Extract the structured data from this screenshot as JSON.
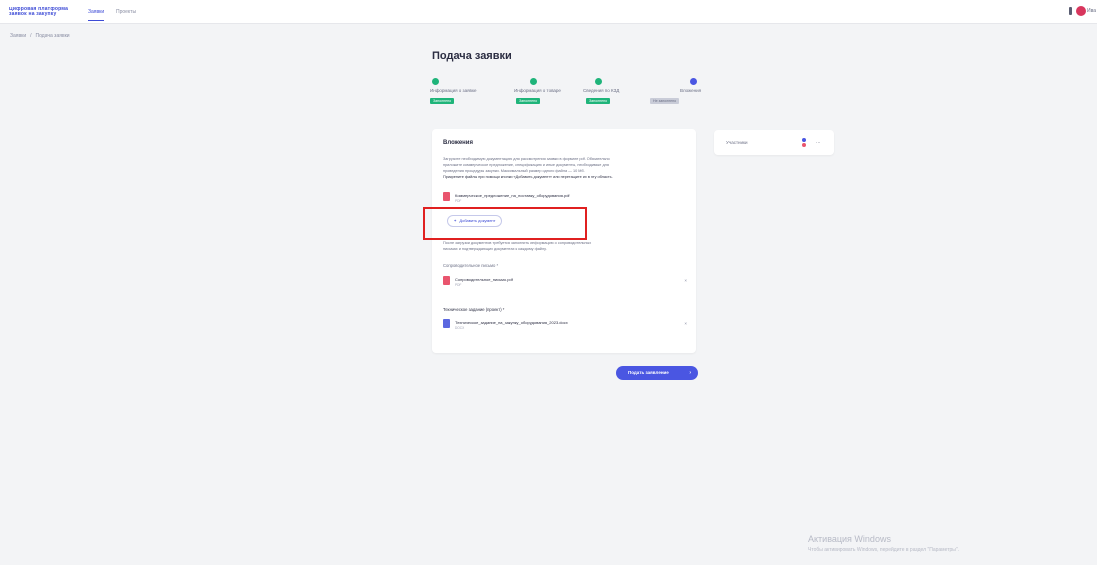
{
  "header": {
    "logo_line1": "Цифровая платформа",
    "logo_line2": "заявок на закупку",
    "tabs": [
      {
        "label": "Заявки",
        "active": true
      },
      {
        "label": "Проекты",
        "active": false
      }
    ],
    "user_label": "Ива"
  },
  "breadcrumb": {
    "items": [
      "Заявки",
      "Подача заявки"
    ]
  },
  "page": {
    "title": "Подача заявки"
  },
  "stepper": {
    "steps": [
      {
        "label": "Информация о заявке",
        "status": "Заполнено",
        "state": "done",
        "color": "#1fb47a"
      },
      {
        "label": "Информация о товаре",
        "status": "Заполнено",
        "state": "done",
        "color": "#1fb47a"
      },
      {
        "label": "Сведения по КЗД",
        "status": "Заполнено",
        "state": "done",
        "color": "#1fb47a"
      },
      {
        "label": "Вложения",
        "status": "Не заполнено",
        "state": "current",
        "color": "#4a56e2"
      }
    ]
  },
  "card": {
    "title": "Вложения",
    "description": [
      "Загрузите необходимую документацию для рассмотрения заявки в формате pdf. Обязательно",
      "приложите коммерческое предложение, спецификацию и иные документы, необходимые для",
      "проведения процедуры закупки. Максимальный размер одного файла — 10 Мб.",
      "Прикрепите файлы при помощи кнопки «Добавить документ» или перетащите их в эту область."
    ],
    "file1": {
      "name": "Коммерческое_предложение_на_поставку_оборудования.pdf",
      "sub": "PDF"
    },
    "add_button": "Добавить документ",
    "note": [
      "После загрузки документов требуется заполнить информацию о сопроводительных",
      "письмах и подтверждающих документах к каждому файлу."
    ],
    "section1_label": "Сопроводительное письмо *",
    "file2": {
      "name": "Сопроводительное_письмо.pdf",
      "sub": "PDF",
      "action": "×"
    },
    "section2_label": "Техническое задание (проект) *",
    "file3": {
      "name": "Техническое_задание_на_закупку_оборудования_2023.docx",
      "sub": "DOCX",
      "action": "×"
    }
  },
  "side_panel": {
    "label": "Участники",
    "chevron": "⋯"
  },
  "submit": {
    "label": "Подать заявление",
    "arrow": "›"
  },
  "watermark": {
    "line1": "Активация Windows",
    "line2": "Чтобы активировать Windows, перейдите в раздел \"Параметры\"."
  }
}
